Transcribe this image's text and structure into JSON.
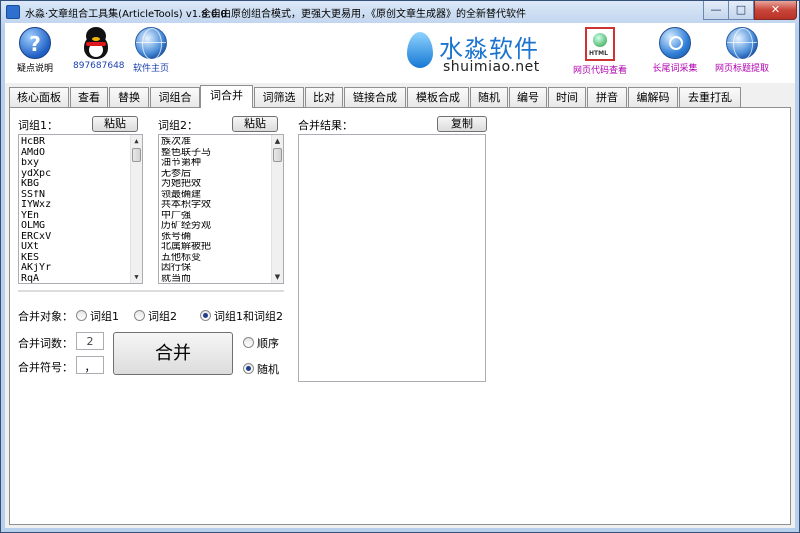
{
  "window": {
    "title": "水淼·文章组合工具集(ArticleTools) v1.8.0.0",
    "slogan": "全自由原创组合模式，更强大更易用，《原创文章生成器》的全新替代软件",
    "minimize": "—",
    "maximize": "□",
    "close": "✕"
  },
  "toolbar": {
    "help_label": "疑点说明",
    "help_glyph": "?",
    "qq_label": "897687648",
    "home_label": "软件主页",
    "brand_cn": "水淼软件",
    "brand_en": "shuimiao.net",
    "html_view_label": "网页代码查看",
    "html_tag": "HTML",
    "longtail_label": "长尾词采集",
    "title_extract_label": "网页标题提取"
  },
  "tabs": [
    "核心面板",
    "查看",
    "替换",
    "词组合",
    "词合并",
    "词筛选",
    "比对",
    "链接合成",
    "模板合成",
    "随机",
    "编号",
    "时间",
    "拼音",
    "编解码",
    "去重打乱"
  ],
  "active_tab": 4,
  "group1": {
    "label": "词组1：",
    "paste": "粘贴",
    "items": [
      "HcBR",
      "AMdO",
      "bxy",
      "ydXpc",
      "KBG",
      "SSfN",
      "IYWxz",
      "YEn",
      "OLMG",
      "ERCxV",
      "UXt",
      "KES",
      "AKjYr",
      "RqA"
    ]
  },
  "group2": {
    "label": "词组2：",
    "paste": "粘贴",
    "items": [
      "族次准",
      "整色联子马",
      "油节第种",
      "无参后",
      "为她把效",
      "领最确建",
      "共本积学效",
      "中广强",
      "历矿经劳观",
      "张号确",
      "北属解被把",
      "五他标变",
      "因行保",
      "就当而"
    ]
  },
  "result": {
    "label": "合并结果：",
    "copy": "复制",
    "value": ""
  },
  "merge_target": {
    "label": "合并对象：",
    "options": [
      "词组1",
      "词组2",
      "词组1和词组2"
    ],
    "selected": 2
  },
  "merge_count": {
    "label": "合并词数：",
    "value": "2"
  },
  "merge_symbol": {
    "label": "合并符号：",
    "value": "，"
  },
  "merge_button": "合并",
  "order": {
    "options": [
      "顺序",
      "随机"
    ],
    "selected": 1
  },
  "scroll": {
    "up": "▲",
    "down": "▼"
  }
}
